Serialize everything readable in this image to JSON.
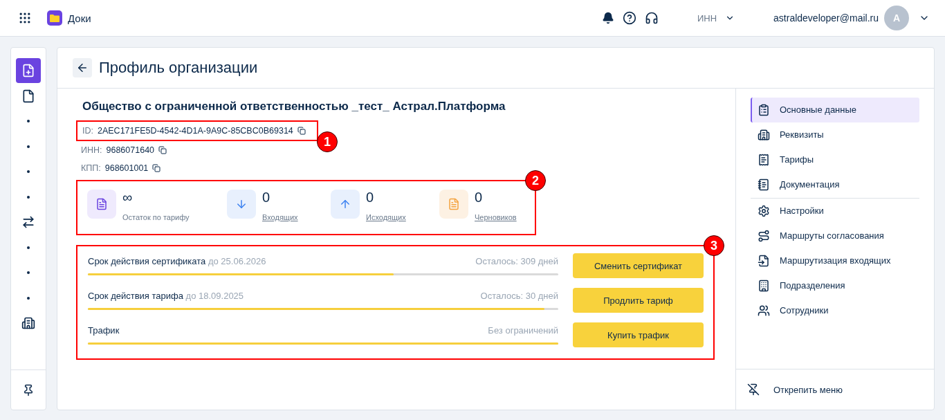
{
  "header": {
    "app_name": "Доки",
    "inn_label": "ИНН",
    "user_email": "astraldeveloper@mail.ru",
    "avatar_letter": "A"
  },
  "rail": {
    "items": [
      {
        "kind": "create",
        "selected": true
      },
      {
        "kind": "document",
        "selected": false
      },
      {
        "kind": "dot",
        "selected": false
      },
      {
        "kind": "dot",
        "selected": false
      },
      {
        "kind": "dot",
        "selected": false
      },
      {
        "kind": "dot",
        "selected": false
      },
      {
        "kind": "exchange",
        "selected": false
      },
      {
        "kind": "dot",
        "selected": false
      },
      {
        "kind": "dot",
        "selected": false
      },
      {
        "kind": "dot",
        "selected": false
      },
      {
        "kind": "building",
        "selected": false
      }
    ]
  },
  "page": {
    "title": "Профиль организации"
  },
  "organization": {
    "name": "Общество с ограниченной ответственностью _тест_ Астрал.Платформа",
    "fields": [
      {
        "label": "ID:",
        "value": "2AEC171FE5D-4542-4D1A-9A9C-85CBC0B69314",
        "callout": "1"
      },
      {
        "label": "ИНН:",
        "value": "9686071640"
      },
      {
        "label": "КПП:",
        "value": "968601001"
      }
    ]
  },
  "stats": {
    "callout": "2",
    "items": [
      {
        "kind": "tariff",
        "value": "∞",
        "label": "Остаток по тарифу",
        "link": false
      },
      {
        "kind": "incoming",
        "value": "0",
        "label": "Входящих",
        "link": true
      },
      {
        "kind": "outgoing",
        "value": "0",
        "label": "Исходящих",
        "link": true
      },
      {
        "kind": "draft",
        "value": "0",
        "label": "Черновиков",
        "link": true
      }
    ]
  },
  "limits": {
    "callout": "3",
    "items": [
      {
        "title": "Срок действия сертификата",
        "date": "до 25.06.2026",
        "remaining": "Осталось: 309 дней",
        "level": 0.65,
        "button": "Сменить сертификат"
      },
      {
        "title": "Срок действия тарифа",
        "date": "до 18.09.2025",
        "remaining": "Осталось: 30 дней",
        "level": 0.97,
        "button": "Продлить тариф"
      },
      {
        "title": "Трафик",
        "remaining": "Без ограничений",
        "level": 1,
        "button": "Купить трафик"
      }
    ]
  },
  "nav": {
    "groups": [
      [
        {
          "kind": "clipboard",
          "label": "Основные данные",
          "selected": true
        },
        {
          "kind": "building",
          "label": "Реквизиты",
          "selected": false
        },
        {
          "kind": "receipt",
          "label": "Тарифы",
          "selected": false
        },
        {
          "kind": "doc",
          "label": "Документация",
          "selected": false
        }
      ],
      [
        {
          "kind": "settings",
          "label": "Настройки",
          "selected": false
        },
        {
          "kind": "route",
          "label": "Маршруты согласования",
          "selected": false
        },
        {
          "kind": "input",
          "label": "Маршрутизация входящих",
          "selected": false
        },
        {
          "kind": "office",
          "label": "Подразделения",
          "selected": false
        },
        {
          "kind": "users",
          "label": "Сотрудники",
          "selected": false
        }
      ]
    ],
    "unpin_label": "Открепить меню"
  }
}
